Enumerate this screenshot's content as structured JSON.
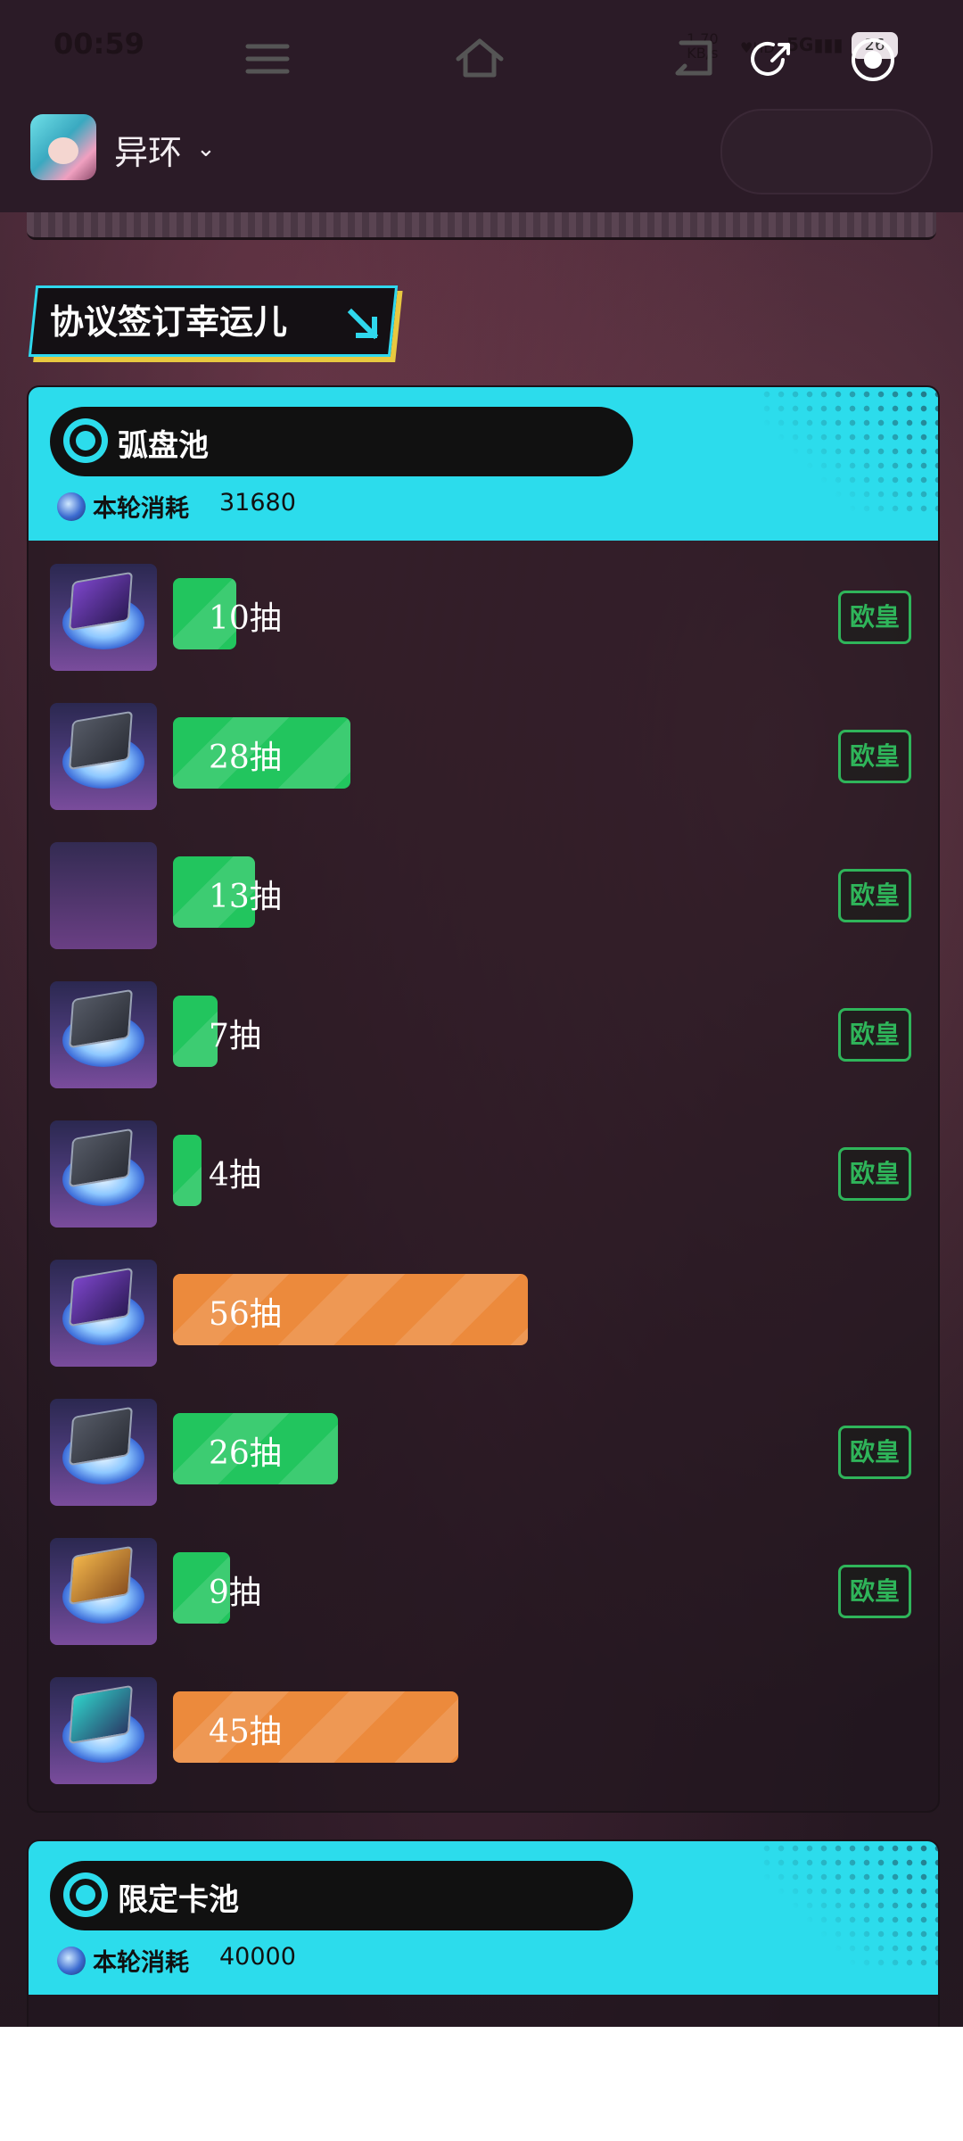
{
  "status_bar": {
    "time": "00:59",
    "net_speed": "1.70",
    "net_unit": "KB/s",
    "hd_label": "HD",
    "signal_label": "5G",
    "battery": "26"
  },
  "header": {
    "app_name": "异环"
  },
  "banner": {
    "title": "协议签订幸运儿"
  },
  "pools": [
    {
      "name": "弧盘池",
      "cost_label": "本轮消耗",
      "cost_value": "31680",
      "rows": [
        {
          "pulls": "10抽",
          "pull_count": 10,
          "color": "#22c55e",
          "badge": "欧皇",
          "icon": "purple"
        },
        {
          "pulls": "28抽",
          "pull_count": 28,
          "color": "#22c55e",
          "badge": "欧皇",
          "icon": "gray"
        },
        {
          "pulls": "13抽",
          "pull_count": 13,
          "color": "#22c55e",
          "badge": "欧皇",
          "icon": "blank"
        },
        {
          "pulls": "7抽",
          "pull_count": 7,
          "color": "#22c55e",
          "badge": "欧皇",
          "icon": "gray"
        },
        {
          "pulls": "4抽",
          "pull_count": 4,
          "color": "#22c55e",
          "badge": "欧皇",
          "icon": "gray"
        },
        {
          "pulls": "56抽",
          "pull_count": 56,
          "color": "#ec8a3c",
          "badge": "",
          "icon": "purple"
        },
        {
          "pulls": "26抽",
          "pull_count": 26,
          "color": "#22c55e",
          "badge": "欧皇",
          "icon": "gray"
        },
        {
          "pulls": "9抽",
          "pull_count": 9,
          "color": "#22c55e",
          "badge": "欧皇",
          "icon": "gold"
        },
        {
          "pulls": "45抽",
          "pull_count": 45,
          "color": "#ec8a3c",
          "badge": "",
          "icon": "teal"
        }
      ]
    },
    {
      "name": "限定卡池",
      "cost_label": "本轮消耗",
      "cost_value": "40000",
      "rows": []
    }
  ],
  "colors": {
    "accent_cyan": "#2cdcec",
    "lucky_green": "#22c55e",
    "unlucky_orange": "#ec8a3c"
  },
  "icons": [
    "share-icon",
    "record-icon",
    "target-icon",
    "crystal-icon",
    "menu-icon",
    "home-icon",
    "back-icon"
  ]
}
